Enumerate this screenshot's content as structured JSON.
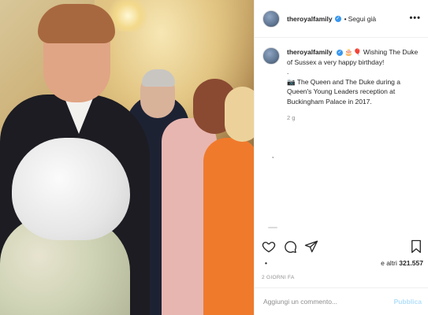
{
  "post": {
    "username": "theroyalfamily",
    "follow_separator": "•",
    "follow_label": "Segui già",
    "more_label": "•••",
    "caption_username": "theroyalfamily",
    "caption_emoji": "🎂🎈",
    "caption_line1": " Wishing The Duke of Sussex a very happy birthday!",
    "caption_dot": ".",
    "caption_line2": "📷 The Queen and The Duke during a Queen's Young Leaders reception at Buckingham Palace in 2017.",
    "caption_time": "2 g",
    "stray_mark": ",",
    "likes_bullet": "•",
    "likes_prefix": "e altri ",
    "likes_count": "321.557",
    "date": "2 GIORNI FA",
    "comment_placeholder": "Aggiungi un commento...",
    "publish_label": "Pubblica"
  },
  "icons": {
    "verified": "verified-badge-icon",
    "like": "heart-icon",
    "comment": "comment-bubble-icon",
    "share": "paper-plane-icon",
    "save": "bookmark-icon"
  },
  "colors": {
    "verified": "#3897f0",
    "publish": "#b2dffc",
    "muted": "#8e8e8e",
    "border": "#efefef"
  }
}
